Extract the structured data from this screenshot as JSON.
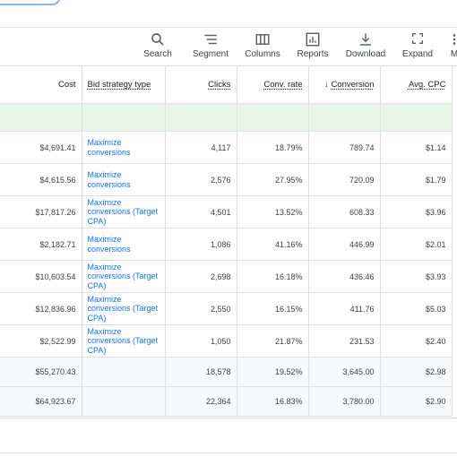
{
  "toolbar": {
    "search": "Search",
    "segment": "Segment",
    "columns": "Columns",
    "reports": "Reports",
    "download": "Download",
    "expand": "Expand",
    "more": "M"
  },
  "columns": {
    "cost": "Cost",
    "bid_strategy": "Bid strategy type",
    "clicks": "Clicks",
    "conv_rate": "Conv. rate",
    "conversions": "Conversion",
    "avg_cpc": "Avg. CPC"
  },
  "rows": [
    {
      "cost": "$4,691.41",
      "bid": "Maximize conversions",
      "clicks": "4,117",
      "conv_rate": "18.79%",
      "conversions": "789.74",
      "cpc": "$1.14"
    },
    {
      "cost": "$4,615.56",
      "bid": "Maximize conversions",
      "clicks": "2,576",
      "conv_rate": "27.95%",
      "conversions": "720.09",
      "cpc": "$1.79"
    },
    {
      "cost": "$17,817.26",
      "bid": "Maximize conversions (Target CPA)",
      "clicks": "4,501",
      "conv_rate": "13.52%",
      "conversions": "608.33",
      "cpc": "$3.96"
    },
    {
      "cost": "$2,182.71",
      "bid": "Maximize conversions",
      "clicks": "1,086",
      "conv_rate": "41.16%",
      "conversions": "446.99",
      "cpc": "$2.01"
    },
    {
      "cost": "$10,603.54",
      "bid": "Maximize conversions (Target CPA)",
      "clicks": "2,698",
      "conv_rate": "16.18%",
      "conversions": "436.46",
      "cpc": "$3.93"
    },
    {
      "cost": "$12,836.96",
      "bid": "Maximize conversions (Target CPA)",
      "clicks": "2,550",
      "conv_rate": "16.15%",
      "conversions": "411.76",
      "cpc": "$5.03"
    },
    {
      "cost": "$2,522.99",
      "bid": "Maximize conversions (Target CPA)",
      "clicks": "1,050",
      "conv_rate": "21.87%",
      "conversions": "231.53",
      "cpc": "$2.40"
    }
  ],
  "totals": [
    {
      "cost": "$55,270.43",
      "clicks": "18,578",
      "conv_rate": "19.52%",
      "conversions": "3,645.00",
      "cpc": "$2.98"
    },
    {
      "cost": "$64,923.67",
      "clicks": "22,364",
      "conv_rate": "16.83%",
      "conversions": "3,780.00",
      "cpc": "$2.90"
    }
  ]
}
